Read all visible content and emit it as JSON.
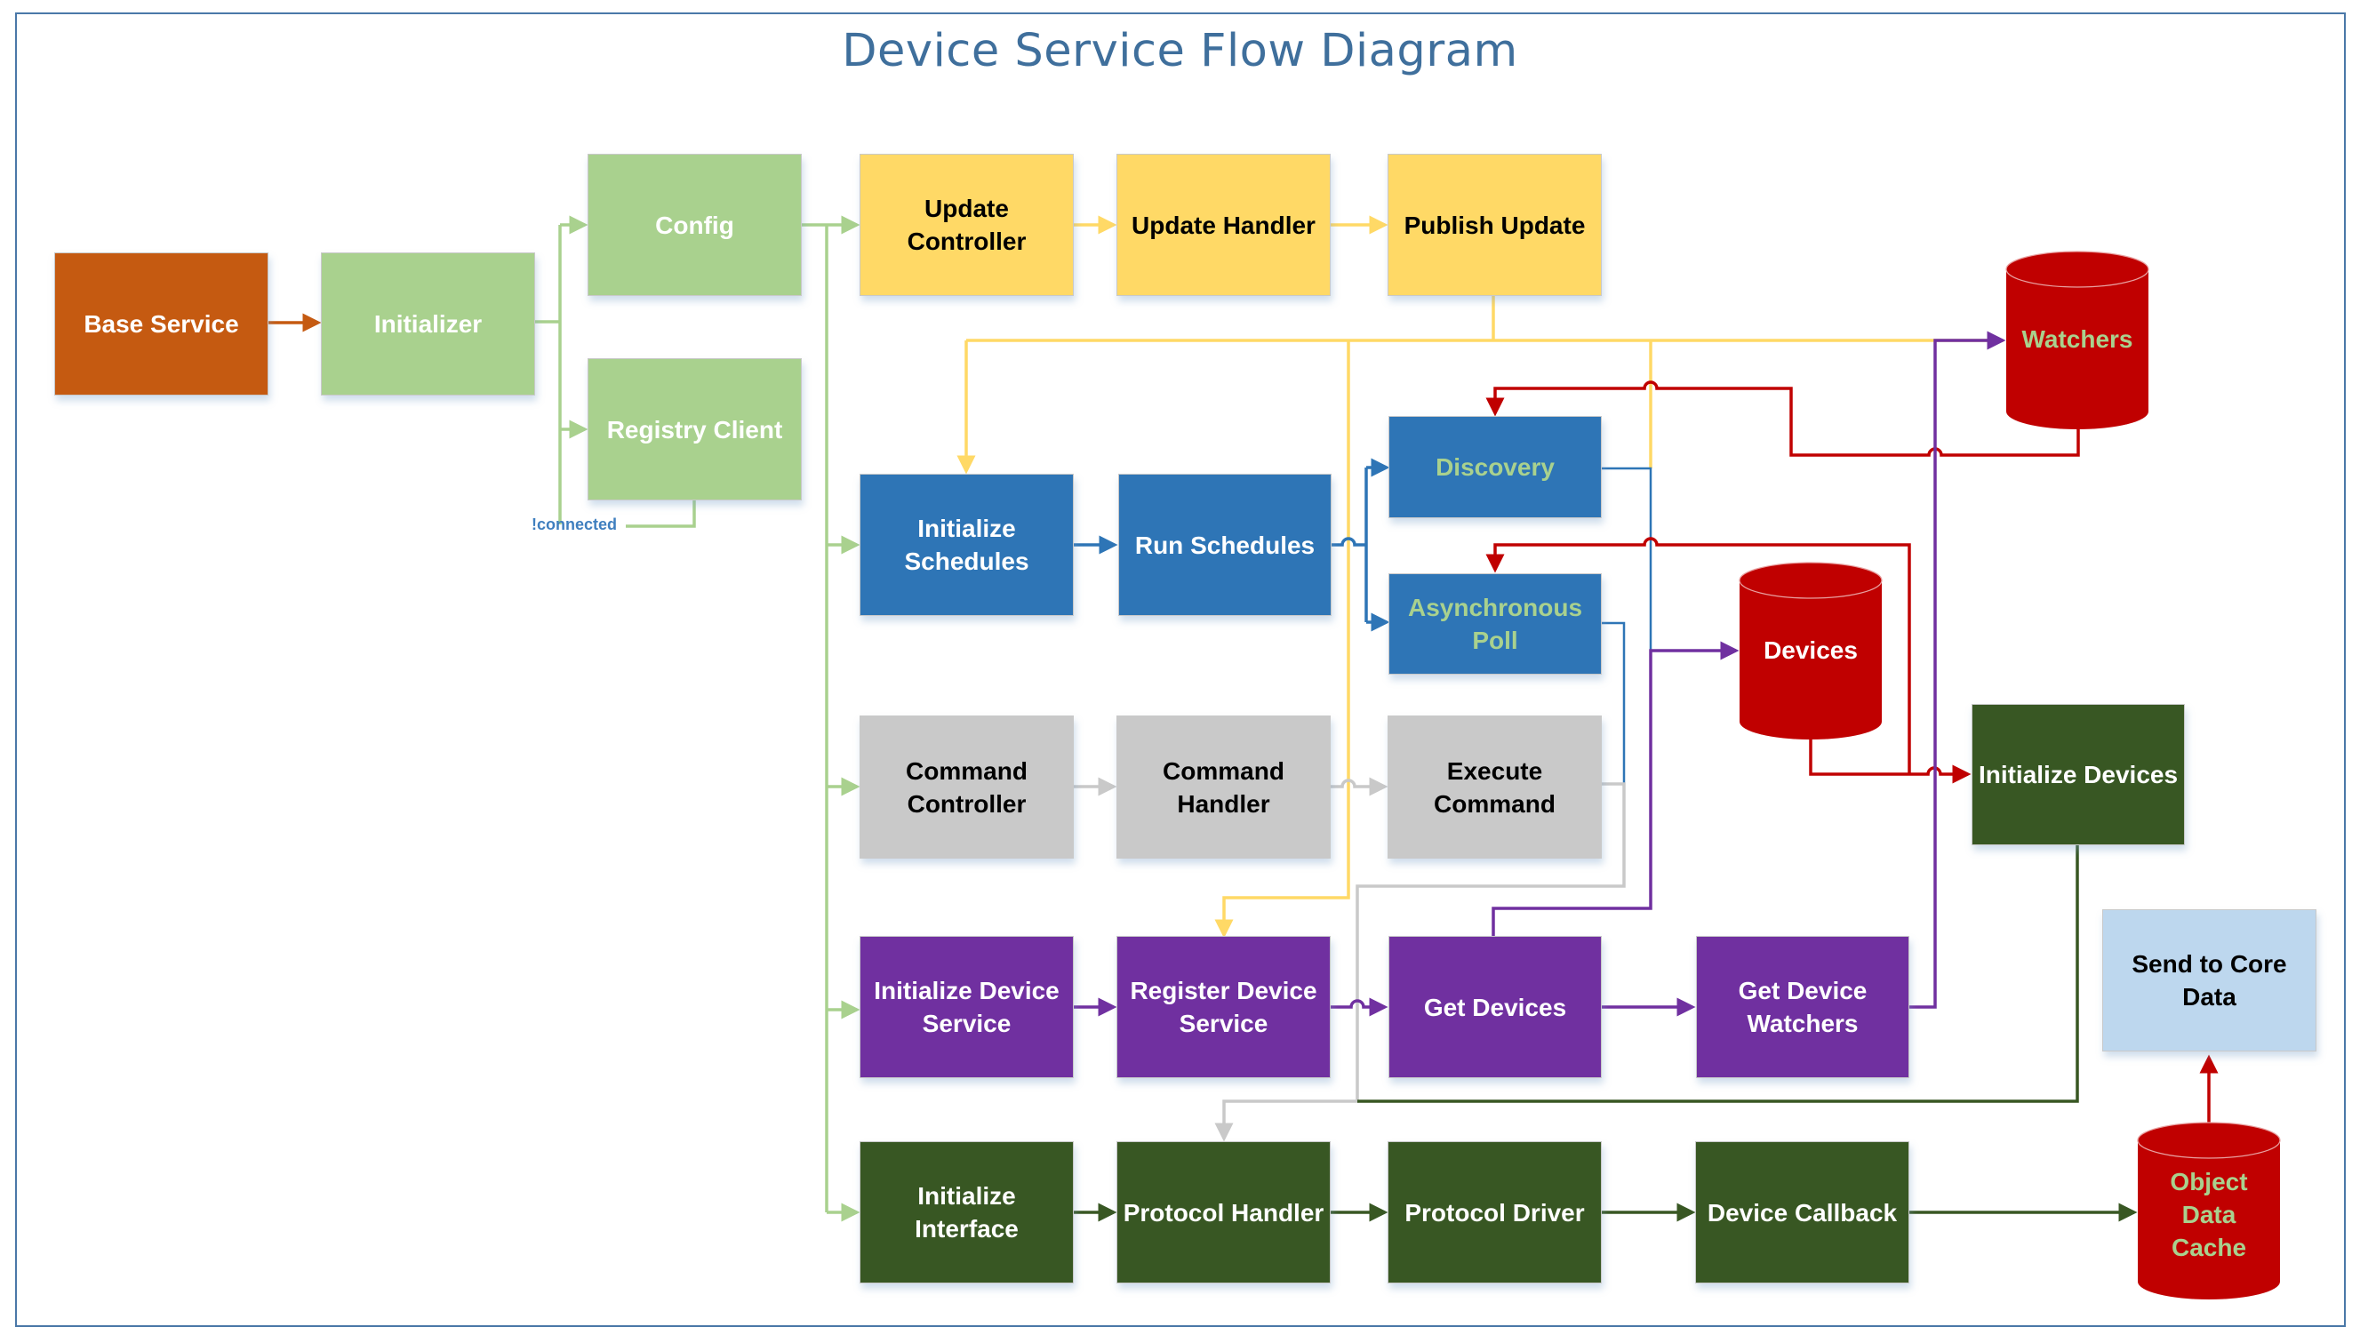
{
  "title": "Device Service Flow Diagram",
  "colors": {
    "frame": "#4a78a8",
    "title": "#3f6f9c",
    "orange": "#c55a11",
    "light_green": "#a9d18e",
    "yellow": "#ffd966",
    "blue": "#2e75b6",
    "gray": "#c9c9c9",
    "purple": "#7030a0",
    "dark_green": "#385723",
    "light_blue": "#bdd7ee",
    "datastore_red": "#c00000"
  },
  "nodes": {
    "base_service": "Base Service",
    "initializer": "Initializer",
    "config": "Config",
    "registry_client": "Registry Client",
    "update_controller": "Update Controller",
    "update_handler": "Update Handler",
    "publish_update": "Publish Update",
    "initialize_schedules": "Initialize Schedules",
    "run_schedules": "Run Schedules",
    "discovery": "Discovery",
    "asynchronous_poll": "Asynchronous Poll",
    "command_controller": "Command Controller",
    "command_handler": "Command Handler",
    "execute_command": "Execute Command",
    "initialize_device_service": "Initialize Device Service",
    "register_device_service": "Register Device Service",
    "get_devices": "Get Devices",
    "get_device_watchers": "Get Device Watchers",
    "initialize_devices": "Initialize Devices",
    "initialize_interface": "Initialize Interface",
    "protocol_handler": "Protocol Handler",
    "protocol_driver": "Protocol Driver",
    "device_callback": "Device Callback",
    "send_to_core_data": "Send to Core Data"
  },
  "datastores": {
    "watchers": "Watchers",
    "devices": "Devices",
    "object_data_cache": "Object Data Cache"
  },
  "edge_labels": {
    "registry_not_connected": "!connected"
  },
  "edges": [
    {
      "from": "Base Service",
      "to": "Initializer",
      "color": "orange"
    },
    {
      "from": "Initializer",
      "to": "Config",
      "color": "light_green"
    },
    {
      "from": "Initializer",
      "to": "Registry Client",
      "color": "light_green"
    },
    {
      "from": "Registry Client",
      "to": "Initializer",
      "label": "!connected",
      "color": "light_green"
    },
    {
      "from": "Config",
      "to": "Update Controller",
      "color": "light_green"
    },
    {
      "from": "Config",
      "to": "Initialize Schedules",
      "color": "light_green"
    },
    {
      "from": "Config",
      "to": "Command Controller",
      "color": "light_green"
    },
    {
      "from": "Config",
      "to": "Initialize Device Service",
      "color": "light_green"
    },
    {
      "from": "Config",
      "to": "Initialize Interface",
      "color": "light_green"
    },
    {
      "from": "Update Controller",
      "to": "Update Handler",
      "color": "yellow"
    },
    {
      "from": "Update Handler",
      "to": "Publish Update",
      "color": "yellow"
    },
    {
      "from": "Publish Update",
      "to": "Initialize Schedules",
      "color": "yellow"
    },
    {
      "from": "Publish Update",
      "to": "Register Device Service",
      "color": "yellow"
    },
    {
      "from": "Publish Update",
      "to": "Watchers",
      "color": "yellow"
    },
    {
      "from": "Initialize Schedules",
      "to": "Run Schedules",
      "color": "blue"
    },
    {
      "from": "Run Schedules",
      "to": "Discovery",
      "color": "blue"
    },
    {
      "from": "Run Schedules",
      "to": "Asynchronous Poll",
      "color": "blue"
    },
    {
      "from": "Watchers",
      "to": "Discovery",
      "color": "datastore_red"
    },
    {
      "from": "Devices",
      "to": "Asynchronous Poll",
      "color": "datastore_red"
    },
    {
      "from": "Devices",
      "to": "Initialize Devices",
      "color": "datastore_red"
    },
    {
      "from": "Command Controller",
      "to": "Command Handler",
      "color": "gray"
    },
    {
      "from": "Command Handler",
      "to": "Execute Command",
      "color": "gray"
    },
    {
      "from": "Execute Command",
      "to": "Protocol Handler",
      "color": "gray"
    },
    {
      "from": "Initialize Device Service",
      "to": "Register Device Service",
      "color": "purple"
    },
    {
      "from": "Register Device Service",
      "to": "Get Devices",
      "color": "purple"
    },
    {
      "from": "Get Devices",
      "to": "Get Device Watchers",
      "color": "purple"
    },
    {
      "from": "Get Devices",
      "to": "Devices",
      "color": "purple"
    },
    {
      "from": "Get Device Watchers",
      "to": "Watchers",
      "color": "purple"
    },
    {
      "from": "Initialize Devices",
      "to": "Protocol Handler",
      "color": "dark_green"
    },
    {
      "from": "Initialize Interface",
      "to": "Protocol Handler",
      "color": "dark_green"
    },
    {
      "from": "Protocol Handler",
      "to": "Protocol Driver",
      "color": "dark_green"
    },
    {
      "from": "Protocol Driver",
      "to": "Device Callback",
      "color": "dark_green"
    },
    {
      "from": "Device Callback",
      "to": "Object Data Cache",
      "color": "dark_green"
    },
    {
      "from": "Object Data Cache",
      "to": "Send to Core Data",
      "color": "datastore_red"
    }
  ]
}
